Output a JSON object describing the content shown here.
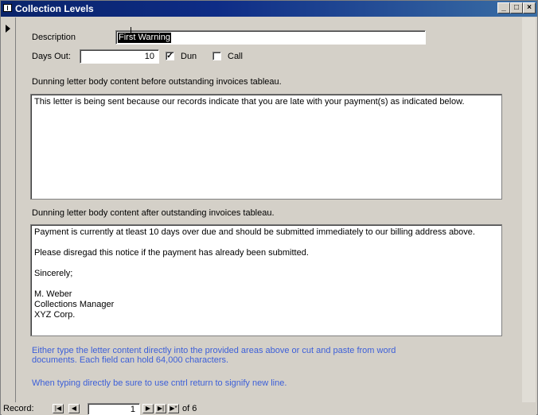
{
  "window": {
    "title": "Collection Levels",
    "min_glyph": "_",
    "max_glyph": "□",
    "close_glyph": "×"
  },
  "form": {
    "description_label": "Description",
    "description_value": "First Warning",
    "days_out_label": "Days Out:",
    "days_out_value": "10",
    "dun_label": "Dun",
    "dun_checked": true,
    "dun_glyph": "✓",
    "call_label": "Call",
    "call_checked": false,
    "before_label": "Dunning letter body content before outstanding invoices tableau.",
    "before_text": "This letter is being sent because our records indicate that you are late with your payment(s) as indicated below.",
    "after_label": "Dunning letter body content after outstanding invoices tableau.",
    "after_lines": [
      "Payment is currently at tleast 10 days over due and should be submitted immediately to our billing address above.",
      "",
      "Please disregad this notice if the payment has already been submitted.",
      "",
      "Sincerely;",
      "",
      "M. Weber",
      "Collections Manager",
      "XYZ Corp."
    ],
    "note_line1": "Either type the letter content directly into the provided areas above or cut and paste from word",
    "note_line2": "documents.  Each field can hold 64,000 characters.",
    "note_line3": "When typing directly be sure to use cntrl return to signify new line."
  },
  "navigation": {
    "record_label": "Record:",
    "current_record": "1",
    "of_text": "of  6",
    "first_glyph": "|◀",
    "prev_glyph": "◀",
    "next_glyph": "▶",
    "last_glyph": "▶|",
    "new_glyph": "▶*"
  }
}
